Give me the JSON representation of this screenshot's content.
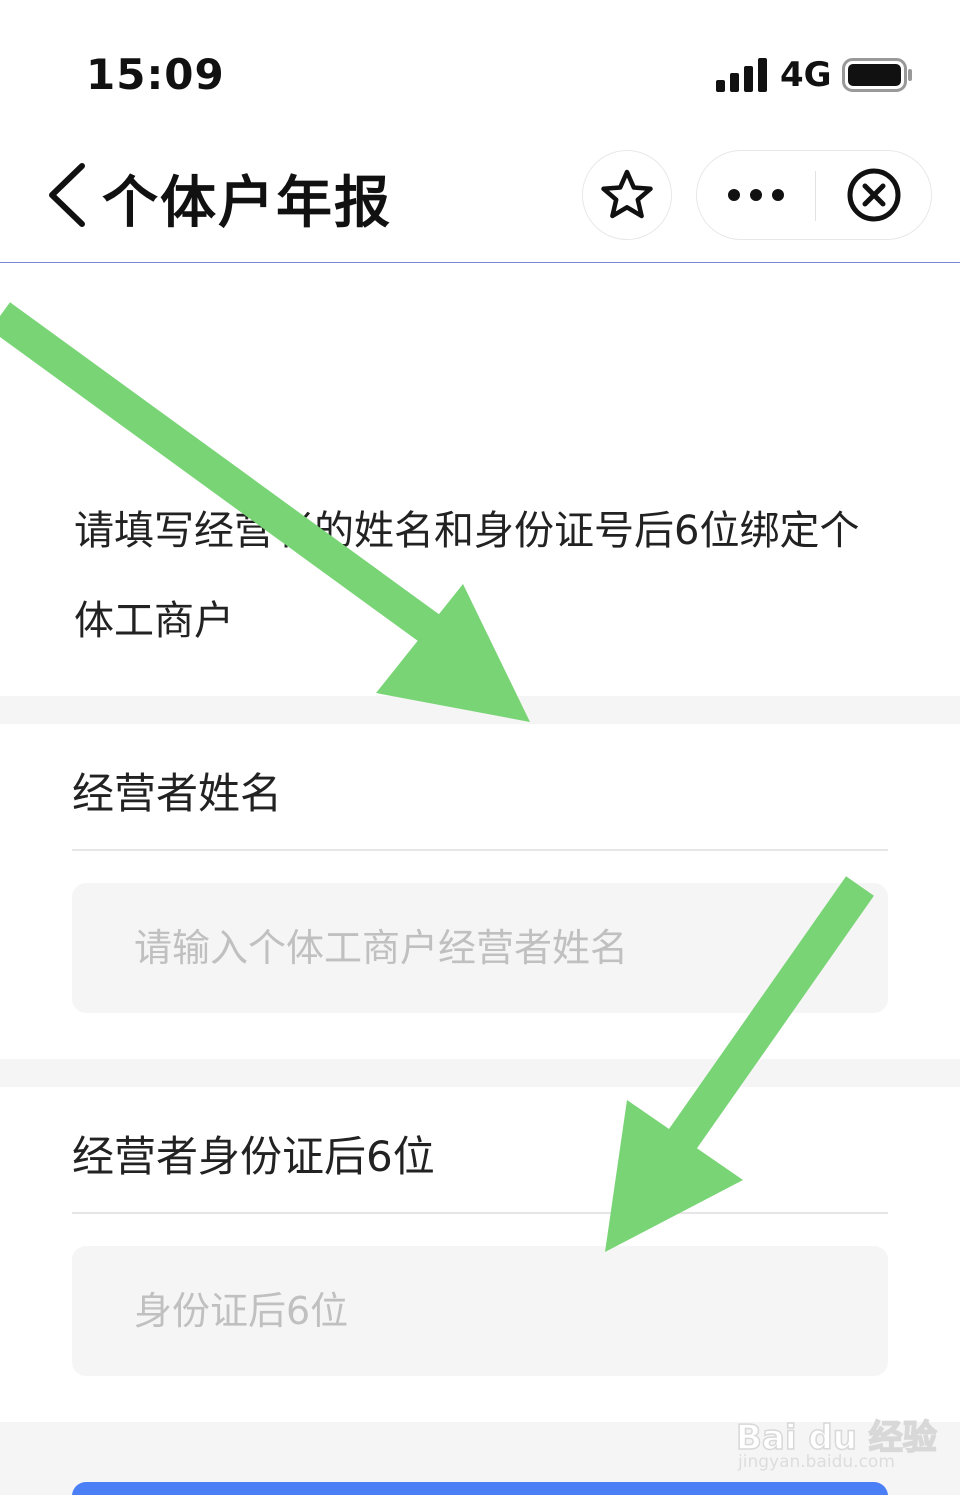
{
  "status_bar": {
    "time": "15:09",
    "network": "4G"
  },
  "nav": {
    "title": "个体户年报",
    "icons": [
      "chevron-left-icon",
      "star-icon",
      "more-dots-icon",
      "close-circle-icon"
    ]
  },
  "intro": {
    "text": "请填写经营者的姓名和身份证号后6位绑定个体工商户"
  },
  "form": {
    "name_field": {
      "label": "经营者姓名",
      "value": "",
      "placeholder": "请输入个体工商户经营者姓名"
    },
    "id_field": {
      "label": "经营者身份证后6位",
      "value": "",
      "placeholder": "身份证后6位"
    }
  },
  "watermark": {
    "logo": "Bai du 经验",
    "url": "jingyan.baidu.com"
  },
  "colors": {
    "nav_border": "#7c86d6",
    "section_gap": "#f5f5f5",
    "input_bg": "#f5f5f5",
    "placeholder": "#c0c0c0",
    "submit_button": "#4a7ff5",
    "annotation_arrow": "#79d475"
  }
}
